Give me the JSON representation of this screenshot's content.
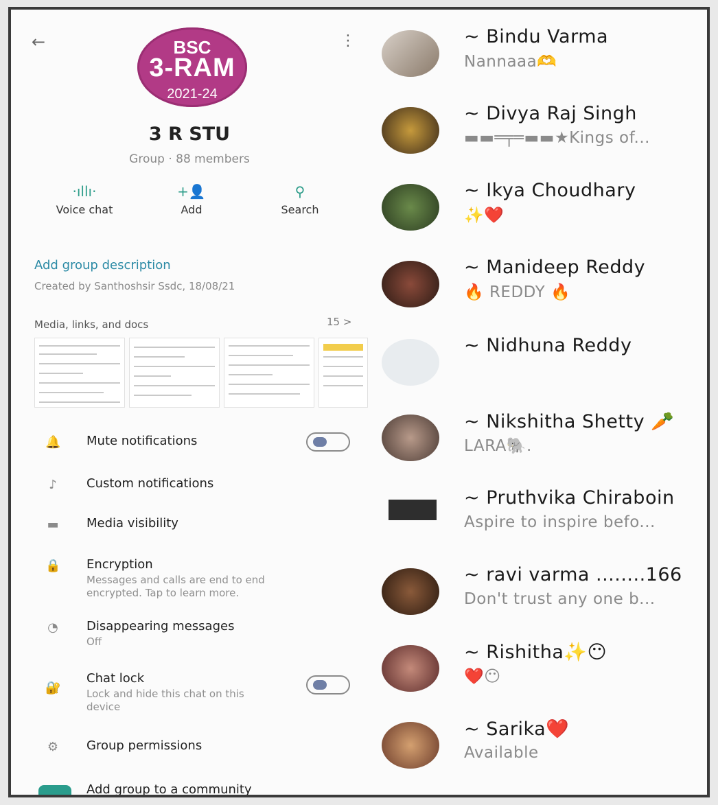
{
  "group": {
    "avatar_line1": "BSC",
    "avatar_line2": "3-RAM",
    "avatar_line3": "2021-24",
    "name": "3 R STU",
    "meta": "Group · 88 members",
    "avatar_color": "#b23a86"
  },
  "actions": [
    {
      "label": "Voice chat",
      "icon": "voice-chat-icon"
    },
    {
      "label": "Add",
      "icon": "add-person-icon"
    },
    {
      "label": "Search",
      "icon": "search-icon"
    }
  ],
  "description": {
    "link": "Add group description",
    "created": "Created by Santhoshsir Ssdc, 18/08/21"
  },
  "media": {
    "title": "Media, links, and docs",
    "count": "15 >"
  },
  "settings": [
    {
      "title": "Mute notifications",
      "icon": "bell-icon"
    },
    {
      "title": "Custom notifications",
      "icon": "music-note-icon"
    },
    {
      "title": "Media visibility",
      "icon": "image-icon"
    },
    {
      "title": "Encryption",
      "subtitle": "Messages and calls are end to end encrypted. Tap to learn more.",
      "icon": "lock-icon"
    },
    {
      "title": "Disappearing messages",
      "subtitle": "Off",
      "icon": "timer-icon"
    },
    {
      "title": "Chat lock",
      "subtitle": "Lock and hide this chat on this device",
      "icon": "chat-lock-icon"
    },
    {
      "title": "Group permissions",
      "icon": "gear-icon"
    },
    {
      "title": "Add group to a community",
      "icon": "community-icon"
    }
  ],
  "members": [
    {
      "name": "~ Bindu Varma",
      "status": "Nannaaa🫶"
    },
    {
      "name": "~ Divya Raj Singh",
      "status": "▬▬═╤═▬▬★Kings of..."
    },
    {
      "name": "~ Ikya Choudhary",
      "status": "✨❤️"
    },
    {
      "name": "~ Manideep Reddy",
      "status": "🔥 REDDY 🔥"
    },
    {
      "name": "~ Nidhuna Reddy",
      "status": ""
    },
    {
      "name": "~ Nikshitha Shetty 🥕",
      "status": "LARA🐘."
    },
    {
      "name": "~ Pruthvika Chiraboin",
      "status": "Aspire to inspire befo..."
    },
    {
      "name": "~ ravi varma ........166",
      "status": "Don't trust any one b..."
    },
    {
      "name": "~ Rishitha✨😶",
      "status": "❤️😶"
    },
    {
      "name": "~ Sarika❤️",
      "status": "Available"
    }
  ],
  "colors": {
    "accent": "#2e9d8a",
    "link": "#2b8aa5"
  }
}
